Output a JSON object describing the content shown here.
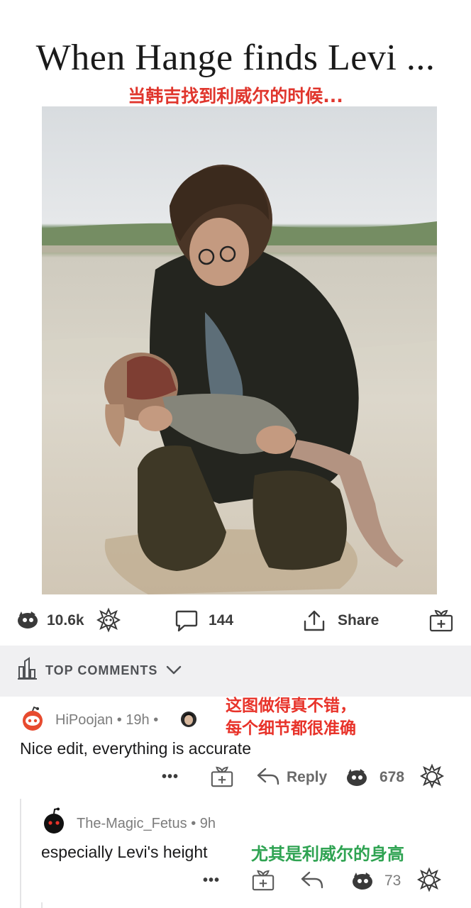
{
  "post": {
    "title": "When Hange finds Levi ...",
    "subtitle": "当韩吉找到利威尔的时候...",
    "upvotes": "10.6k",
    "comments_count": "144",
    "share_label": "Share"
  },
  "section": {
    "label": "TOP COMMENTS"
  },
  "comments": [
    {
      "author": "HiPoojan",
      "time": "19h",
      "separator": "•",
      "text": "Nice edit, everything is accurate",
      "annotation_line1": "这图做得真不错，",
      "annotation_line2": "每个细节都很准确",
      "more": "•••",
      "reply_label": "Reply",
      "score": "678"
    },
    {
      "author": "The-Magic_Fetus",
      "time": "9h",
      "separator": "•",
      "text": "especially Levi's height",
      "annotation": "尤其是利威尔的身高",
      "more": "•••",
      "score": "73"
    }
  ],
  "colors": {
    "annotation_red": "#e8332a",
    "annotation_green": "#2fa352",
    "section_bg": "#f0f0f2",
    "meta_gray": "#7c7c7c"
  }
}
